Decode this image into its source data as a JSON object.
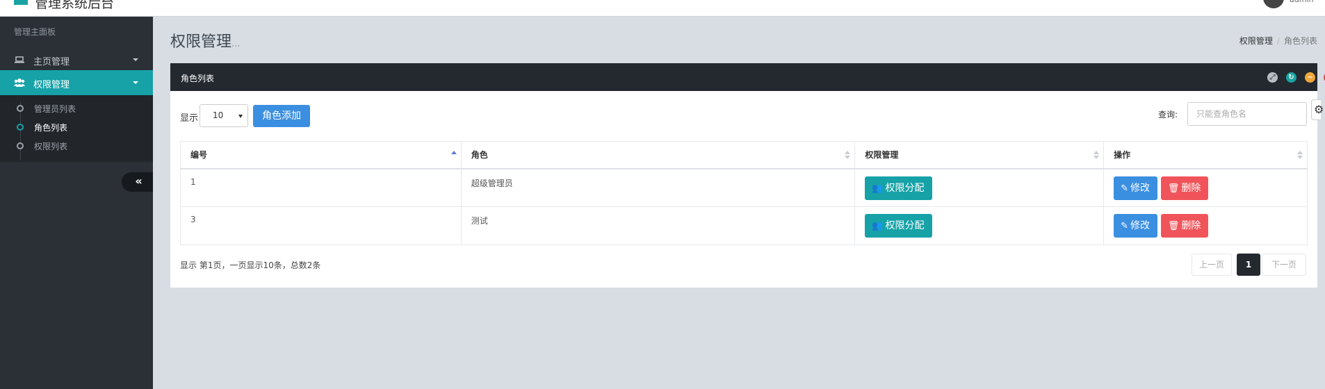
{
  "app": {
    "title": "管理系统后台",
    "user": "admin"
  },
  "sidebar": {
    "heading": "管理主面板",
    "items": [
      {
        "label": "主页管理",
        "icon": "laptop-icon"
      },
      {
        "label": "权限管理",
        "icon": "users-icon"
      }
    ],
    "subitems": [
      {
        "label": "管理员列表"
      },
      {
        "label": "角色列表"
      },
      {
        "label": "权限列表"
      }
    ],
    "collapse_label": "«"
  },
  "page": {
    "title": "权限管理",
    "title_suffix": "..."
  },
  "breadcrumb": {
    "items": [
      "权限管理",
      "角色列表"
    ],
    "separator": "/"
  },
  "panel": {
    "title": "角色列表",
    "show_label": "显示",
    "page_size": "10",
    "add_button": "角色添加",
    "search_label": "查询:",
    "search_placeholder": "只能查角色名",
    "columns": [
      "编号",
      "角色",
      "权限管理",
      "操作"
    ],
    "rows": [
      {
        "id": "1",
        "role": "超级管理员"
      },
      {
        "id": "3",
        "role": "测试"
      }
    ],
    "assign_label": "权限分配",
    "edit_label": "修改",
    "delete_label": "删除",
    "info": "显示 第1页，一页显示10条，总数2条",
    "pager": {
      "prev": "上一页",
      "current": "1",
      "next": "下一页"
    }
  },
  "colors": {
    "accent": "#16a2a7",
    "primary": "#3b8fe0",
    "danger": "#f0545a",
    "sidebar": "#2b3037",
    "header": "#242930"
  }
}
